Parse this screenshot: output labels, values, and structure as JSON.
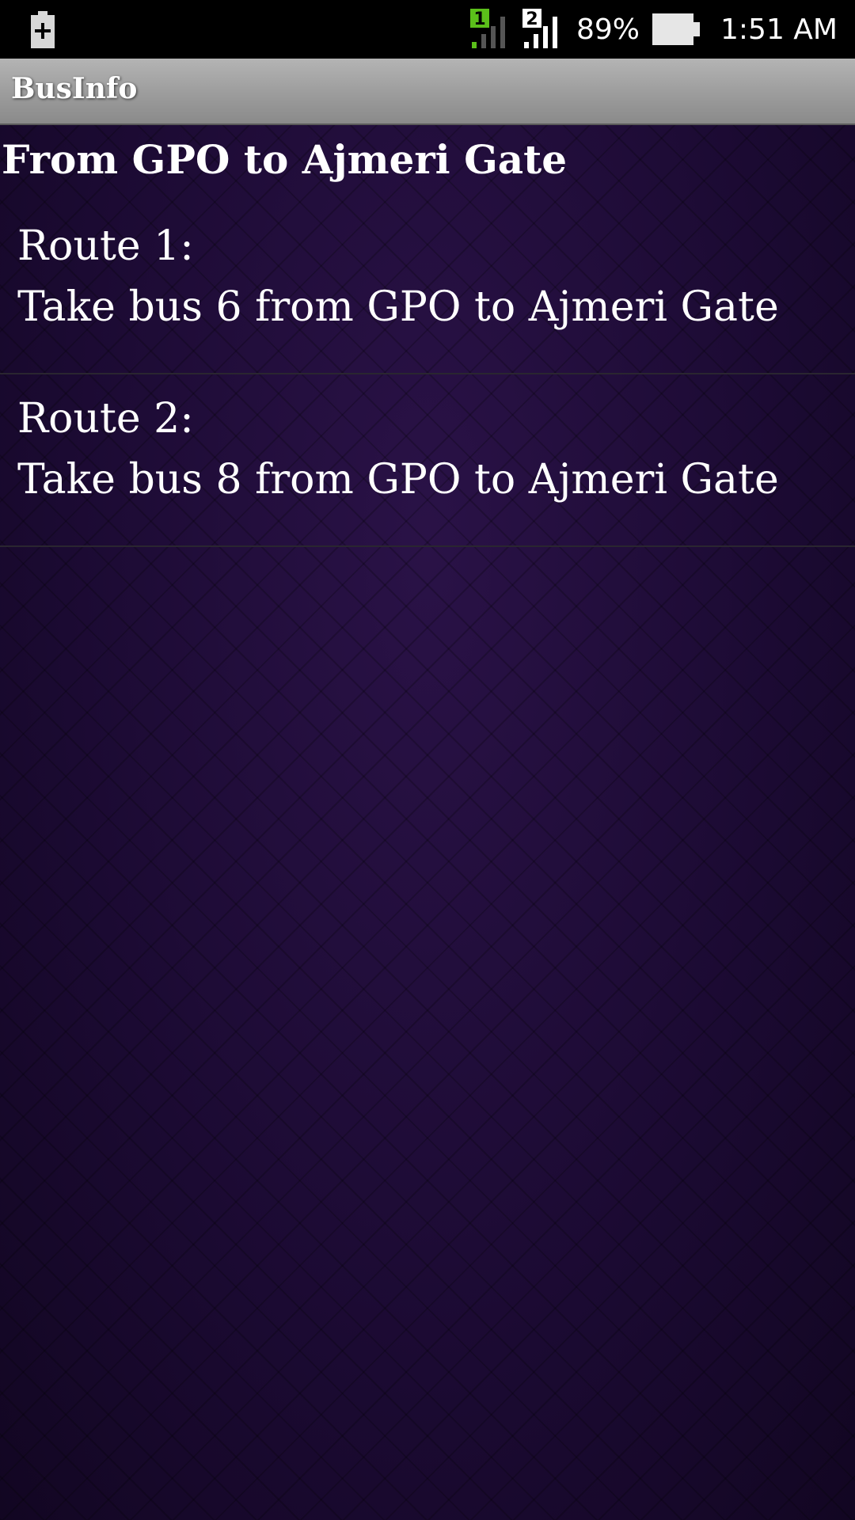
{
  "status_bar": {
    "left_icon": "battery-charging-icon",
    "sim1_label": "1",
    "sim2_label": "2",
    "battery_percent": "89%",
    "time": "1:51 AM",
    "colors": {
      "sim1": "#5bbf1a",
      "active_bar": "#ffffff",
      "inactive_bar": "#555555"
    }
  },
  "app_bar": {
    "title": "BusInfo"
  },
  "main": {
    "heading": "From GPO to Ajmeri Gate",
    "routes": [
      {
        "title": "Route 1:",
        "description": "Take bus 6 from GPO to Ajmeri Gate"
      },
      {
        "title": "Route 2:",
        "description": "Take bus 8 from GPO to Ajmeri Gate"
      }
    ]
  }
}
